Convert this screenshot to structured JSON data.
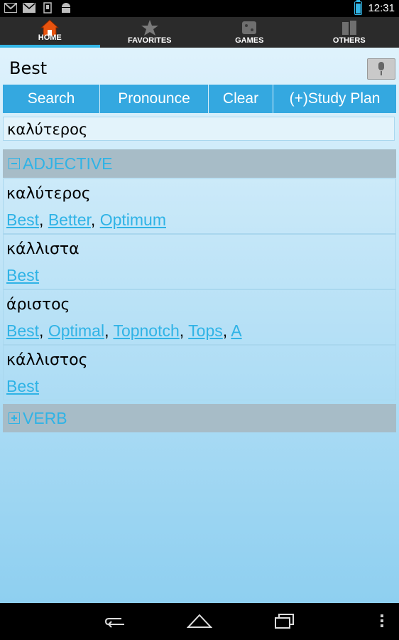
{
  "status": {
    "time": "12:31",
    "icons": [
      "gmail-icon",
      "mail-icon",
      "download-icon",
      "android-icon"
    ]
  },
  "tabs": [
    {
      "label": "HOME",
      "icon": "home-icon",
      "active": true
    },
    {
      "label": "FAVORITES",
      "icon": "star-icon",
      "active": false
    },
    {
      "label": "GAMES",
      "icon": "games-icon",
      "active": false
    },
    {
      "label": "OTHERS",
      "icon": "others-icon",
      "active": false
    }
  ],
  "search": {
    "value": "Best",
    "mic_icon": "microphone-icon"
  },
  "buttons": {
    "search": "Search",
    "pronounce": "Pronounce",
    "clear": "Clear",
    "study_plan": "(+)Study Plan"
  },
  "main_translation": "καλύτερος",
  "sections": {
    "adjective": "ADJECTIVE",
    "verb": "VERB"
  },
  "entries": [
    {
      "word": "καλύτερος",
      "links": [
        "Best",
        "Better",
        "Optimum"
      ]
    },
    {
      "word": "κάλλιστα",
      "links": [
        "Best"
      ]
    },
    {
      "word": "άριστος",
      "links": [
        "Best",
        "Optimal",
        "Topnotch",
        "Tops",
        "A"
      ]
    },
    {
      "word": "κάλλιστος",
      "links": [
        "Best"
      ]
    }
  ],
  "colors": {
    "accent": "#33b5e5",
    "button": "#34a8e0",
    "section_bg": "#a7bcc7"
  }
}
